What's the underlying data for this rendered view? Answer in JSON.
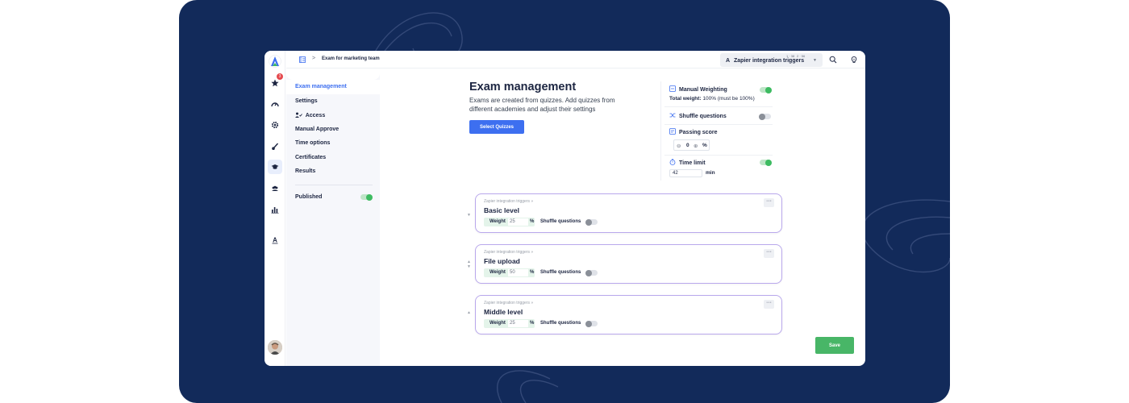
{
  "breadcrumb": {
    "separator": ">",
    "current": "Exam for marketing team"
  },
  "topbar": {
    "integration_select": {
      "icon_letter": "A",
      "label": "Zapier integration triggers",
      "mini_left": "1 · 38",
      "mini_right": "2 · 56"
    }
  },
  "rail": {
    "notification_count": "3",
    "logo_letter": "A"
  },
  "nav": {
    "items": [
      {
        "label": "Exam management"
      },
      {
        "label": "Settings"
      },
      {
        "label": "Access"
      },
      {
        "label": "Manual Approve"
      },
      {
        "label": "Time options"
      },
      {
        "label": "Certificates"
      },
      {
        "label": "Results"
      }
    ],
    "published_label": "Published",
    "published": true
  },
  "header": {
    "title": "Exam management",
    "description": "Exams are created from quizzes. Add quizzes from different academies and adjust their settings",
    "select_button": "Select Quizzes"
  },
  "settings": {
    "manual_weighting": {
      "label": "Manual Weighting",
      "enabled": true
    },
    "total_weight_label": "Total weight:",
    "total_weight_value": "100% (must be 100%)",
    "shuffle": {
      "label": "Shuffle questions",
      "enabled": false
    },
    "passing_score": {
      "label": "Passing score",
      "value": "0",
      "minus": "⊖",
      "plus": "⊕",
      "unit": "%"
    },
    "time_limit": {
      "label": "Time limit",
      "enabled": true,
      "value": "42",
      "unit": "min"
    }
  },
  "quizzes": [
    {
      "source": "Zapier integration triggers »",
      "title": "Basic level",
      "weight_label": "Weight",
      "weight": "25",
      "pct": "%",
      "shuffle_label": "Shuffle questions",
      "more": "···"
    },
    {
      "source": "Zapier integration triggers »",
      "title": "File upload",
      "weight_label": "Weight",
      "weight": "50",
      "pct": "%",
      "shuffle_label": "Shuffle questions",
      "more": "···"
    },
    {
      "source": "Zapier integration triggers »",
      "title": "Middle level",
      "weight_label": "Weight",
      "weight": "25",
      "pct": "%",
      "shuffle_label": "Shuffle questions",
      "more": "···"
    }
  ],
  "footer": {
    "save_label": "Save"
  },
  "colors": {
    "primary": "#3d6ff0",
    "success": "#48b667",
    "background": "#122a5a",
    "card_border": "#b9a8ec"
  }
}
